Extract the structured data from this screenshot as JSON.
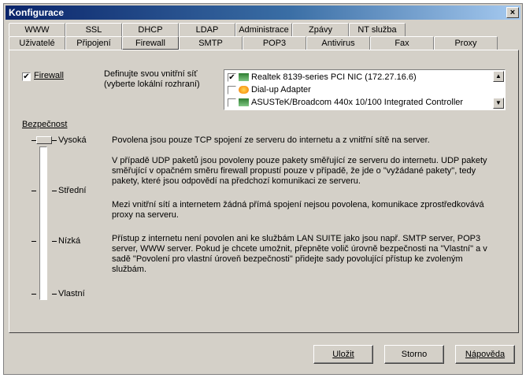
{
  "window": {
    "title": "Konfigurace",
    "close_glyph": "×"
  },
  "tabs_back": [
    "WWW",
    "SSL",
    "DHCP",
    "LDAP",
    "Administrace",
    "Zpávy",
    "NT služba"
  ],
  "tabs_front": [
    "Uživatelé",
    "Připojení",
    "Firewall",
    "SMTP",
    "POP3",
    "Antivirus",
    "Fax",
    "Proxy"
  ],
  "active_tab": "Firewall",
  "firewall": {
    "checkbox_label": "Firewall",
    "checked": true,
    "description": "Definujte svou vnitřní síť (vyberte lokální rozhraní)"
  },
  "interfaces": [
    {
      "label": "Realtek 8139-series PCI NIC (172.27.16.6)",
      "checked": true,
      "icon": "nic-icon"
    },
    {
      "label": "Dial-up Adapter",
      "checked": false,
      "icon": "dialup-icon"
    },
    {
      "label": "ASUSTeK/Broadcom 440x 10/100 Integrated Controller",
      "checked": false,
      "icon": "nic-icon"
    }
  ],
  "security": {
    "label": "Bezpečnost",
    "levels": [
      "Vysoká",
      "Střední",
      "Nízká",
      "Vlastní"
    ],
    "selected": "Vysoká",
    "descriptions": [
      "Povolena jsou pouze TCP spojení ze serveru do internetu a z vnitřní sítě na server.",
      "V případě UDP paketů jsou povoleny pouze pakety směřující ze serveru do internetu. UDP pakety směřující v opačném směru firewall propustí pouze v případě, že jde o \"vyžádané pakety\", tedy pakety, které jsou odpovědí na předchozí komunikaci ze serveru.",
      "Mezi vnitřní sítí a internetem žádná přímá spojení nejsou povolena, komunikace zprostředkovává proxy na serveru.",
      "Přístup z internetu není povolen ani ke službám LAN SUITE jako jsou např. SMTP server, POP3 server, WWW server. Pokud je chcete umožnit, přepněte volič úrovně bezpečnosti na \"Vlastní\" a v sadě \"Povolení pro vlastní úroveň bezpečnosti\" přidejte sady povolující přístup ke zvoleným službám."
    ]
  },
  "buttons": {
    "save": "Uložit",
    "cancel": "Storno",
    "help": "Nápověda"
  },
  "colors": {
    "titlebar_start": "#0a246a",
    "titlebar_end": "#a6caf0",
    "face": "#d4d0c8"
  }
}
